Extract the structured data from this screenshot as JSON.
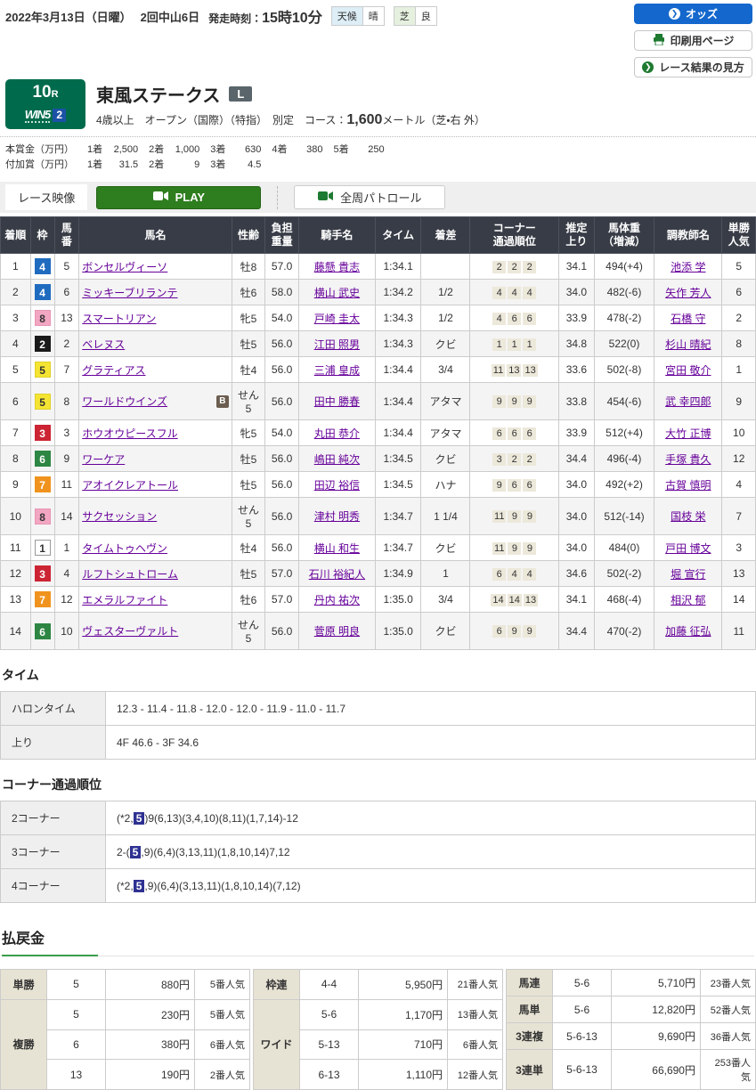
{
  "header": {
    "date": "2022年3月13日（日曜）",
    "meet": "2回中山6日",
    "start_label": "発走時刻：",
    "start_time": "15時10分",
    "weather_label": "天候",
    "weather_value": "晴",
    "turf_label": "芝",
    "turf_value": "良",
    "odds_button": "オッズ",
    "print_button": "印刷用ページ",
    "guide_button": "レース結果の見方"
  },
  "race": {
    "number": "10",
    "number_suffix": "R",
    "win5_text": "WIN5",
    "win5_number": "2",
    "title": "東風ステークス",
    "grade": "L",
    "conditions": "4歳以上　オープン（国際）（特指）　別定　",
    "course_label": "コース：",
    "course_value": "1,600",
    "course_unit": "メートル（芝・右 外）",
    "prize_main_label": "本賞金（万円）",
    "prize_main": [
      [
        "1着",
        "2,500"
      ],
      [
        "2着",
        "1,000"
      ],
      [
        "3着",
        "630"
      ],
      [
        "4着",
        "380"
      ],
      [
        "5着",
        "250"
      ]
    ],
    "prize_extra_label": "付加賞（万円）",
    "prize_extra": [
      [
        "1着",
        "31.5"
      ],
      [
        "2着",
        "9"
      ],
      [
        "3着",
        "4.5"
      ]
    ]
  },
  "video": {
    "label": "レース映像",
    "play": "PLAY",
    "patrol": "全周パトロール"
  },
  "frame_colors": {
    "1": {
      "bg": "#ffffff",
      "fg": "#333333",
      "border": "#999999"
    },
    "2": {
      "bg": "#1a1a1a",
      "fg": "#ffffff",
      "border": "#1a1a1a"
    },
    "3": {
      "bg": "#cc2433",
      "fg": "#ffffff",
      "border": "#cc2433"
    },
    "4": {
      "bg": "#1f6bbf",
      "fg": "#ffffff",
      "border": "#1f6bbf"
    },
    "5": {
      "bg": "#f5e532",
      "fg": "#333333",
      "border": "#e0d02a"
    },
    "6": {
      "bg": "#2d8643",
      "fg": "#ffffff",
      "border": "#2d8643"
    },
    "7": {
      "bg": "#f0931e",
      "fg": "#ffffff",
      "border": "#f0931e"
    },
    "8": {
      "bg": "#f2a6c2",
      "fg": "#333333",
      "border": "#e895b4"
    }
  },
  "results": {
    "headers": [
      "着順",
      "枠",
      "馬\n番",
      "馬名",
      "性齢",
      "負担\n重量",
      "騎手名",
      "タイム",
      "着差",
      "コーナー\n通過順位",
      "推定\n上り",
      "馬体重\n（増減）",
      "調教師名",
      "単勝\n人気"
    ],
    "rows": [
      {
        "pos": "1",
        "frame": "4",
        "num": "5",
        "horse": "ボンセルヴィーソ",
        "badge": "",
        "sex_age": "牡8",
        "weight": "57.0",
        "jockey": "藤懸 貴志",
        "time": "1:34.1",
        "margin": "",
        "corners": [
          "2",
          "2",
          "2"
        ],
        "last3f": "34.1",
        "body_weight": "494(+4)",
        "trainer": "池添 学",
        "popularity": "5"
      },
      {
        "pos": "2",
        "frame": "4",
        "num": "6",
        "horse": "ミッキーブリランテ",
        "badge": "",
        "sex_age": "牡6",
        "weight": "58.0",
        "jockey": "横山 武史",
        "time": "1:34.2",
        "margin": "1/2",
        "corners": [
          "4",
          "4",
          "4"
        ],
        "last3f": "34.0",
        "body_weight": "482(-6)",
        "trainer": "矢作 芳人",
        "popularity": "6"
      },
      {
        "pos": "3",
        "frame": "8",
        "num": "13",
        "horse": "スマートリアン",
        "badge": "",
        "sex_age": "牝5",
        "weight": "54.0",
        "jockey": "戸崎 圭太",
        "time": "1:34.3",
        "margin": "1/2",
        "corners": [
          "4",
          "6",
          "6"
        ],
        "last3f": "33.9",
        "body_weight": "478(-2)",
        "trainer": "石橋 守",
        "popularity": "2"
      },
      {
        "pos": "4",
        "frame": "2",
        "num": "2",
        "horse": "ベレヌス",
        "badge": "",
        "sex_age": "牡5",
        "weight": "56.0",
        "jockey": "江田 照男",
        "time": "1:34.3",
        "margin": "クビ",
        "corners": [
          "1",
          "1",
          "1"
        ],
        "last3f": "34.8",
        "body_weight": "522(0)",
        "trainer": "杉山 晴紀",
        "popularity": "8"
      },
      {
        "pos": "5",
        "frame": "5",
        "num": "7",
        "horse": "グラティアス",
        "badge": "",
        "sex_age": "牡4",
        "weight": "56.0",
        "jockey": "三浦 皇成",
        "time": "1:34.4",
        "margin": "3/4",
        "corners": [
          "11",
          "13",
          "13"
        ],
        "last3f": "33.6",
        "body_weight": "502(-8)",
        "trainer": "宮田 敬介",
        "popularity": "1"
      },
      {
        "pos": "6",
        "frame": "5",
        "num": "8",
        "horse": "ワールドウインズ",
        "badge": "B",
        "sex_age": "せん5",
        "weight": "56.0",
        "jockey": "田中 勝春",
        "time": "1:34.4",
        "margin": "アタマ",
        "corners": [
          "9",
          "9",
          "9"
        ],
        "last3f": "33.8",
        "body_weight": "454(-6)",
        "trainer": "武 幸四郎",
        "popularity": "9"
      },
      {
        "pos": "7",
        "frame": "3",
        "num": "3",
        "horse": "ホウオウピースフル",
        "badge": "",
        "sex_age": "牝5",
        "weight": "54.0",
        "jockey": "丸田 恭介",
        "time": "1:34.4",
        "margin": "アタマ",
        "corners": [
          "6",
          "6",
          "6"
        ],
        "last3f": "33.9",
        "body_weight": "512(+4)",
        "trainer": "大竹 正博",
        "popularity": "10"
      },
      {
        "pos": "8",
        "frame": "6",
        "num": "9",
        "horse": "ワーケア",
        "badge": "",
        "sex_age": "牡5",
        "weight": "56.0",
        "jockey": "嶋田 純次",
        "time": "1:34.5",
        "margin": "クビ",
        "corners": [
          "3",
          "2",
          "2"
        ],
        "last3f": "34.4",
        "body_weight": "496(-4)",
        "trainer": "手塚 貴久",
        "popularity": "12"
      },
      {
        "pos": "9",
        "frame": "7",
        "num": "11",
        "horse": "アオイクレアトール",
        "badge": "",
        "sex_age": "牡5",
        "weight": "56.0",
        "jockey": "田辺 裕信",
        "time": "1:34.5",
        "margin": "ハナ",
        "corners": [
          "9",
          "6",
          "6"
        ],
        "last3f": "34.0",
        "body_weight": "492(+2)",
        "trainer": "古賀 慎明",
        "popularity": "4"
      },
      {
        "pos": "10",
        "frame": "8",
        "num": "14",
        "horse": "サクセッション",
        "badge": "",
        "sex_age": "せん5",
        "weight": "56.0",
        "jockey": "津村 明秀",
        "time": "1:34.7",
        "margin": "1 1/4",
        "corners": [
          "11",
          "9",
          "9"
        ],
        "last3f": "34.0",
        "body_weight": "512(-14)",
        "trainer": "国枝 栄",
        "popularity": "7"
      },
      {
        "pos": "11",
        "frame": "1",
        "num": "1",
        "horse": "タイムトゥヘヴン",
        "badge": "",
        "sex_age": "牡4",
        "weight": "56.0",
        "jockey": "横山 和生",
        "time": "1:34.7",
        "margin": "クビ",
        "corners": [
          "11",
          "9",
          "9"
        ],
        "last3f": "34.0",
        "body_weight": "484(0)",
        "trainer": "戸田 博文",
        "popularity": "3"
      },
      {
        "pos": "12",
        "frame": "3",
        "num": "4",
        "horse": "ルフトシュトローム",
        "badge": "",
        "sex_age": "牡5",
        "weight": "57.0",
        "jockey": "石川 裕紀人",
        "time": "1:34.9",
        "margin": "1",
        "corners": [
          "6",
          "4",
          "4"
        ],
        "last3f": "34.6",
        "body_weight": "502(-2)",
        "trainer": "堀 宣行",
        "popularity": "13"
      },
      {
        "pos": "13",
        "frame": "7",
        "num": "12",
        "horse": "エメラルファイト",
        "badge": "",
        "sex_age": "牡6",
        "weight": "57.0",
        "jockey": "丹内 祐次",
        "time": "1:35.0",
        "margin": "3/4",
        "corners": [
          "14",
          "14",
          "13"
        ],
        "last3f": "34.1",
        "body_weight": "468(-4)",
        "trainer": "相沢 郁",
        "popularity": "14"
      },
      {
        "pos": "14",
        "frame": "6",
        "num": "10",
        "horse": "ヴェスターヴァルト",
        "badge": "",
        "sex_age": "せん5",
        "weight": "56.0",
        "jockey": "菅原 明良",
        "time": "1:35.0",
        "margin": "クビ",
        "corners": [
          "6",
          "9",
          "9"
        ],
        "last3f": "34.4",
        "body_weight": "470(-2)",
        "trainer": "加藤 征弘",
        "popularity": "11"
      }
    ]
  },
  "time_section": {
    "title": "タイム",
    "rows": [
      {
        "label": "ハロンタイム",
        "value": "12.3 - 11.4 - 11.8 - 12.0 - 12.0 - 11.9 - 11.0 - 11.7"
      },
      {
        "label": "上り",
        "value": "4F 46.6 - 3F 34.6"
      }
    ]
  },
  "corner_section": {
    "title": "コーナー通過順位",
    "rows": [
      {
        "label": "2コーナー",
        "pre": "(*2,",
        "hl": "5",
        "post": ")9(6,13)(3,4,10)(8,11)(1,7,14)-12"
      },
      {
        "label": "3コーナー",
        "pre": "2-(",
        "hl": "5",
        "post": ",9)(6,4)(3,13,11)(1,8,10,14)7,12"
      },
      {
        "label": "4コーナー",
        "pre": "(*2,",
        "hl": "5",
        "post": ",9)(6,4)(3,13,11)(1,8,10,14)(7,12)"
      }
    ]
  },
  "payouts": {
    "title": "払戻金",
    "accent_color": "#3a9e4c",
    "col_left": [
      {
        "type": "単勝",
        "rows": [
          {
            "combo": "5",
            "amount": "880円",
            "pop": "5番人気"
          }
        ]
      },
      {
        "type": "複勝",
        "rows": [
          {
            "combo": "5",
            "amount": "230円",
            "pop": "5番人気"
          },
          {
            "combo": "6",
            "amount": "380円",
            "pop": "6番人気"
          },
          {
            "combo": "13",
            "amount": "190円",
            "pop": "2番人気"
          }
        ]
      }
    ],
    "col_mid": [
      {
        "type": "枠連",
        "rows": [
          {
            "combo": "4-4",
            "amount": "5,950円",
            "pop": "21番人気"
          }
        ]
      },
      {
        "type": "ワイド",
        "rows": [
          {
            "combo": "5-6",
            "amount": "1,170円",
            "pop": "13番人気"
          },
          {
            "combo": "5-13",
            "amount": "710円",
            "pop": "6番人気"
          },
          {
            "combo": "6-13",
            "amount": "1,110円",
            "pop": "12番人気"
          }
        ]
      }
    ],
    "col_right": [
      {
        "type": "馬連",
        "rows": [
          {
            "combo": "5-6",
            "amount": "5,710円",
            "pop": "23番人気"
          }
        ]
      },
      {
        "type": "馬単",
        "rows": [
          {
            "combo": "5-6",
            "amount": "12,820円",
            "pop": "52番人気"
          }
        ]
      },
      {
        "type": "3連複",
        "rows": [
          {
            "combo": "5-6-13",
            "amount": "9,690円",
            "pop": "36番人気"
          }
        ]
      },
      {
        "type": "3連単",
        "rows": [
          {
            "combo": "5-6-13",
            "amount": "66,690円",
            "pop": "253番人気"
          }
        ]
      }
    ]
  }
}
